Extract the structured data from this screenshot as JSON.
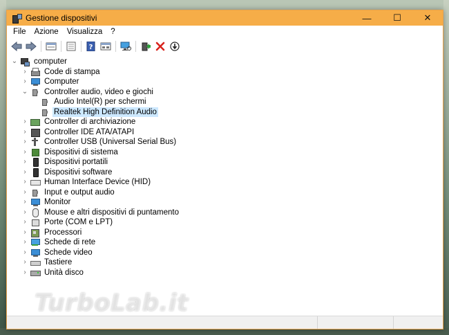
{
  "window": {
    "title": "Gestione dispositivi",
    "controls": {
      "minimize": "—",
      "maximize": "☐",
      "close": "✕"
    },
    "accent": "#f6ad48"
  },
  "menu": [
    "File",
    "Azione",
    "Visualizza",
    "?"
  ],
  "toolbar": {
    "buttons": [
      {
        "name": "back-icon"
      },
      {
        "name": "forward-icon"
      },
      {
        "name": "properties-icon"
      },
      {
        "name": "show-hidden-icon"
      },
      {
        "name": "help-icon"
      },
      {
        "name": "details-icon"
      },
      {
        "name": "scan-hardware-icon"
      },
      {
        "name": "update-driver-icon"
      },
      {
        "name": "uninstall-icon"
      },
      {
        "name": "disable-icon"
      }
    ]
  },
  "tree": {
    "root": "computer",
    "items": [
      {
        "label": "Code di stampa",
        "icon": "printer-icon"
      },
      {
        "label": "Computer",
        "icon": "monitor-icon"
      },
      {
        "label": "Controller audio, video e giochi",
        "icon": "speaker-icon",
        "expanded": true,
        "children": [
          {
            "label": "Audio Intel(R) per schermi",
            "icon": "speaker-icon"
          },
          {
            "label": "Realtek High Definition Audio",
            "icon": "speaker-icon",
            "selected": true
          }
        ]
      },
      {
        "label": "Controller di archiviazione",
        "icon": "storage-icon"
      },
      {
        "label": "Controller IDE ATA/ATAPI",
        "icon": "ide-icon"
      },
      {
        "label": "Controller USB (Universal Serial Bus)",
        "icon": "usb-icon"
      },
      {
        "label": "Dispositivi di sistema",
        "icon": "chip-icon"
      },
      {
        "label": "Dispositivi portatili",
        "icon": "phone-icon"
      },
      {
        "label": "Dispositivi software",
        "icon": "phone-icon"
      },
      {
        "label": "Human Interface Device (HID)",
        "icon": "keyboard-icon"
      },
      {
        "label": "Input e output audio",
        "icon": "speaker-icon"
      },
      {
        "label": "Monitor",
        "icon": "monitor-icon"
      },
      {
        "label": "Mouse e altri dispositivi di puntamento",
        "icon": "mouse-icon"
      },
      {
        "label": "Porte (COM e LPT)",
        "icon": "port-icon"
      },
      {
        "label": "Processori",
        "icon": "cpu-icon"
      },
      {
        "label": "Schede di rete",
        "icon": "network-icon"
      },
      {
        "label": "Schede video",
        "icon": "monitor-icon"
      },
      {
        "label": "Tastiere",
        "icon": "keyboard-icon"
      },
      {
        "label": "Unità disco",
        "icon": "disk-icon"
      }
    ]
  },
  "watermark": "TurboLab.it"
}
